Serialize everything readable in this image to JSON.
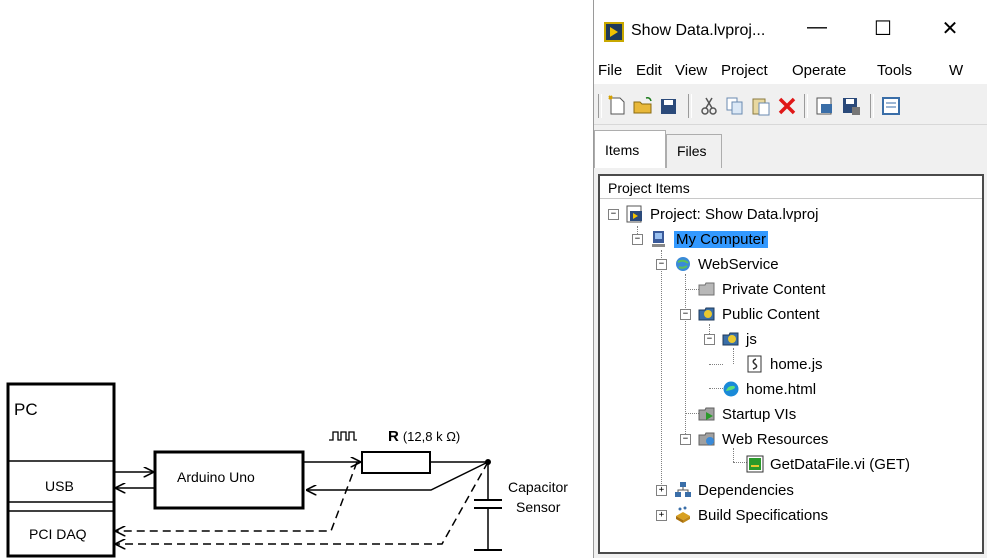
{
  "diagram": {
    "pc": {
      "label": "PC",
      "usb": "USB",
      "pci_daq": "PCI DAQ"
    },
    "arduino": {
      "label": "Arduino Uno"
    },
    "resistor": {
      "label_bold": "R",
      "label_value": "(12,8 k Ω)"
    },
    "pulse_glyph": "⎍⎍",
    "capacitor": {
      "line1": "Capacitor",
      "line2": "Sensor"
    }
  },
  "window": {
    "title": "Show Data.lvproj...",
    "controls": {
      "minimize": "—",
      "maximize": "☐",
      "close": "✕"
    },
    "menu": [
      "File",
      "Edit",
      "View",
      "Project",
      "Operate",
      "Tools",
      "W"
    ],
    "tabs": {
      "items": "Items",
      "files": "Files"
    },
    "tree_header": "Project Items",
    "tree": [
      {
        "label": "Project: Show Data.lvproj",
        "icon": "project-icon"
      },
      {
        "label": "My Computer",
        "icon": "computer-icon",
        "selected": true
      },
      {
        "label": "WebService",
        "icon": "webservice-icon"
      },
      {
        "label": "Private Content",
        "icon": "folder-icon"
      },
      {
        "label": "Public Content",
        "icon": "public-folder-icon"
      },
      {
        "label": "js",
        "icon": "public-folder-icon"
      },
      {
        "label": "home.js",
        "icon": "script-file-icon"
      },
      {
        "label": "home.html",
        "icon": "edge-icon"
      },
      {
        "label": "Startup VIs",
        "icon": "startup-vis-icon"
      },
      {
        "label": "Web Resources",
        "icon": "web-resources-icon"
      },
      {
        "label": "GetDataFile.vi (GET)",
        "icon": "vi-icon"
      },
      {
        "label": "Dependencies",
        "icon": "dependencies-icon"
      },
      {
        "label": "Build Specifications",
        "icon": "build-spec-icon"
      }
    ]
  }
}
